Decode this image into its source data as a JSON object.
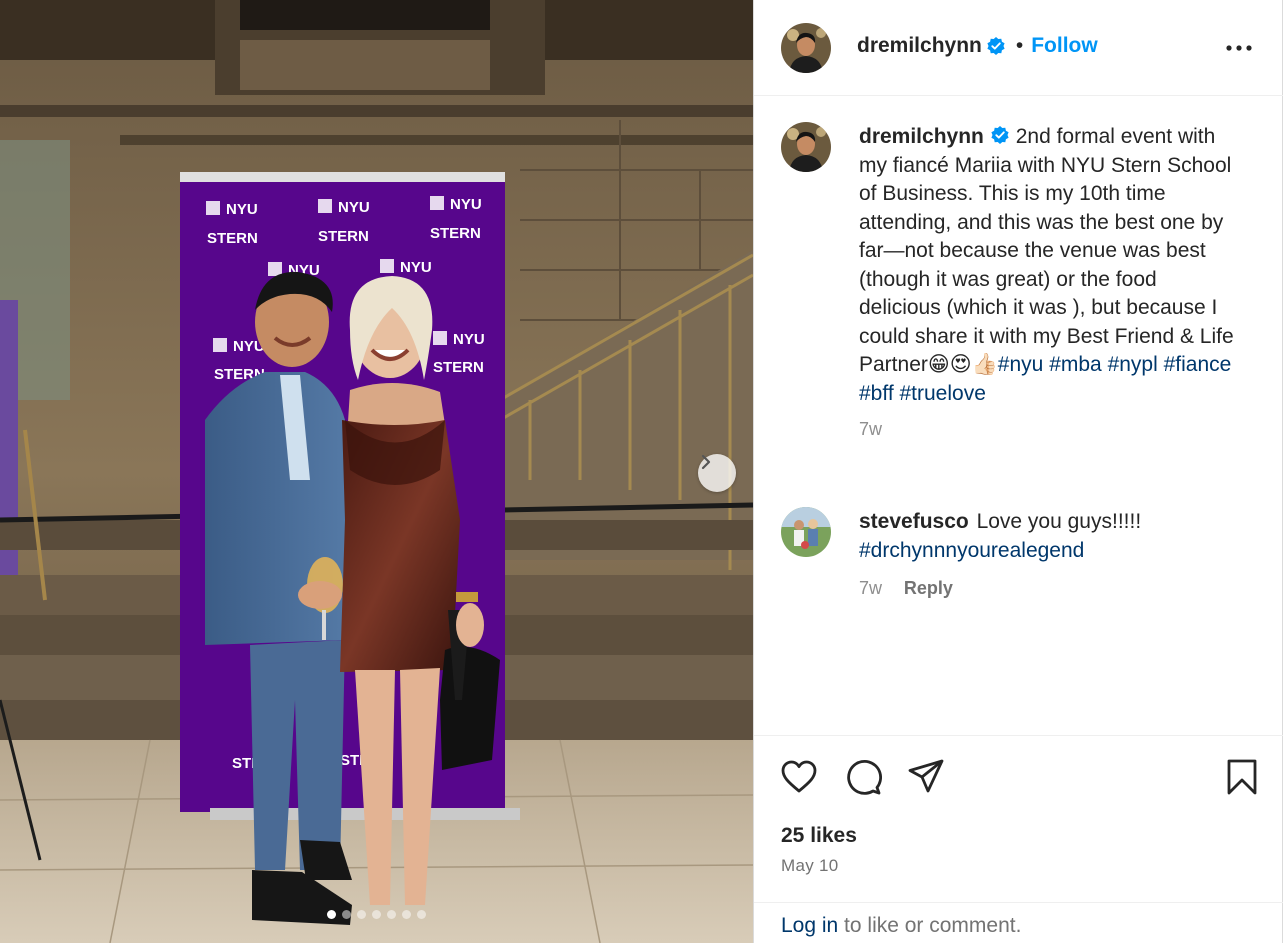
{
  "post": {
    "author": "dremilchynn",
    "follow_label": "Follow",
    "separator": "•",
    "verified": true
  },
  "caption": {
    "username": "dremilchynn",
    "text": "2nd formal event with my fiancé Mariia with NYU Stern School of Business. This is my 10th time attending, and this was the best one by far—not because the venue was best (though it was great) or the food delicious (which it was ), but because I could share it with my Best Friend & Life Partner😁😍👍🏻",
    "hashtags": [
      "#nyu",
      "#mba",
      "#nypl",
      "#fiance",
      "#bff",
      "#truelove"
    ],
    "age": "7w"
  },
  "comment": {
    "username": "stevefusco",
    "text": "Love you guys!!!!!",
    "hashtag": "#drchynnnyourealegend",
    "age": "7w",
    "reply_label": "Reply"
  },
  "stats": {
    "likes": "25 likes",
    "date": "May 10"
  },
  "footer": {
    "login_link": "Log in",
    "login_rest": " to like or comment."
  },
  "photo": {
    "banner_text_top": "NYU",
    "banner_text_bottom": "STERN",
    "carousel_count": 7,
    "carousel_active": 0
  },
  "icons": [
    "heart-icon",
    "comment-icon",
    "share-icon",
    "bookmark-icon",
    "more-icon",
    "verified-icon",
    "chevron-right-icon"
  ],
  "colors": {
    "follow": "#0095f6",
    "hashtag": "#00376b",
    "verified": "#0095f6",
    "banner_purple": "#57068c"
  }
}
